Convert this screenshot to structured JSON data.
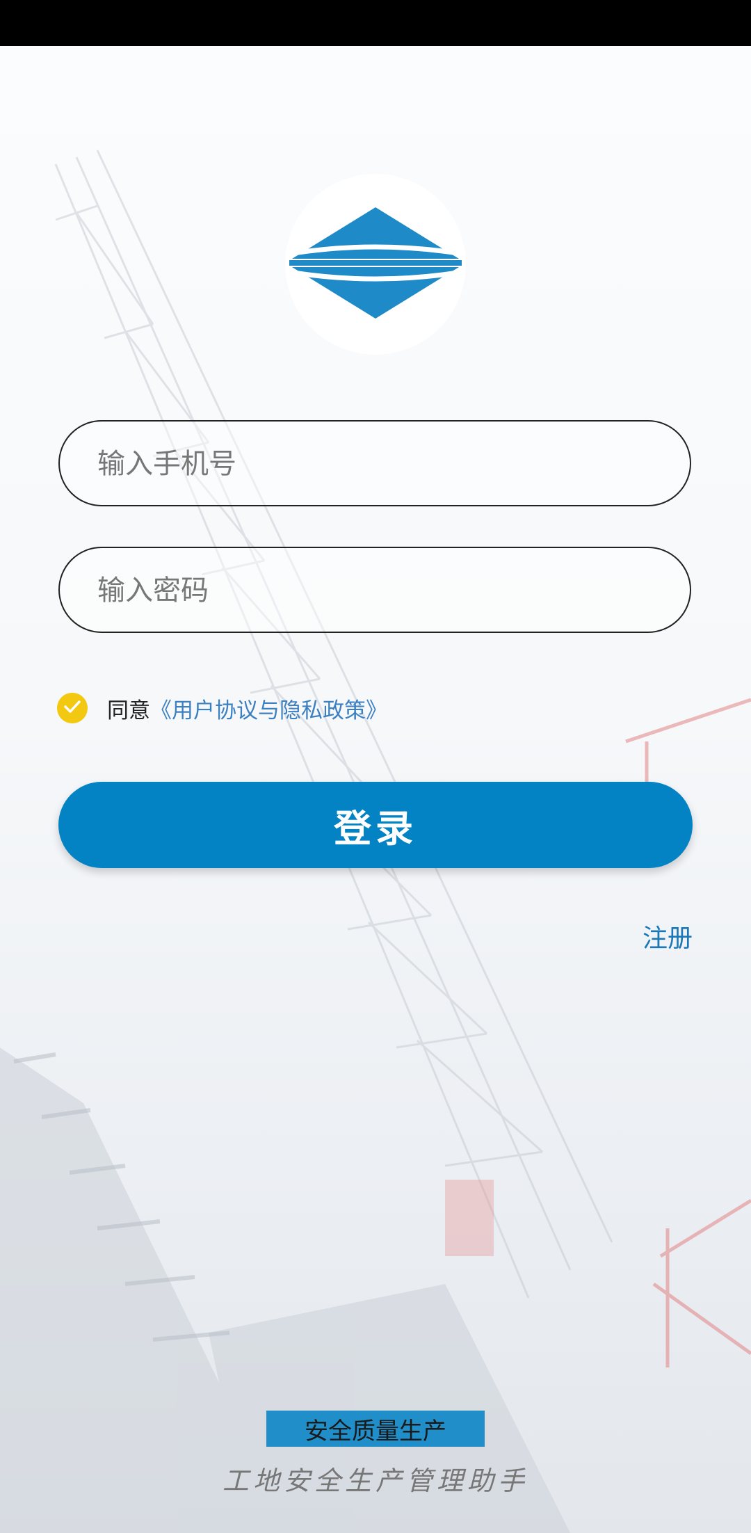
{
  "login": {
    "phone_placeholder": "输入手机号",
    "password_placeholder": "输入密码",
    "agree_prefix": "同意",
    "agree_link": "《用户协议与隐私政策》",
    "agree_checked": true,
    "login_label": "登录",
    "register_label": "注册"
  },
  "footer": {
    "badge": "安全质量生产",
    "slogan": "工地安全生产管理助手"
  },
  "icons": {
    "logo": "diamond-logo-icon",
    "check": "check-icon"
  },
  "colors": {
    "primary": "#0383c4",
    "link": "#3c80c2",
    "register": "#1a78b8",
    "check": "#f2c811",
    "logo": "#1e8ac8",
    "badge": "#1f8ec9"
  }
}
